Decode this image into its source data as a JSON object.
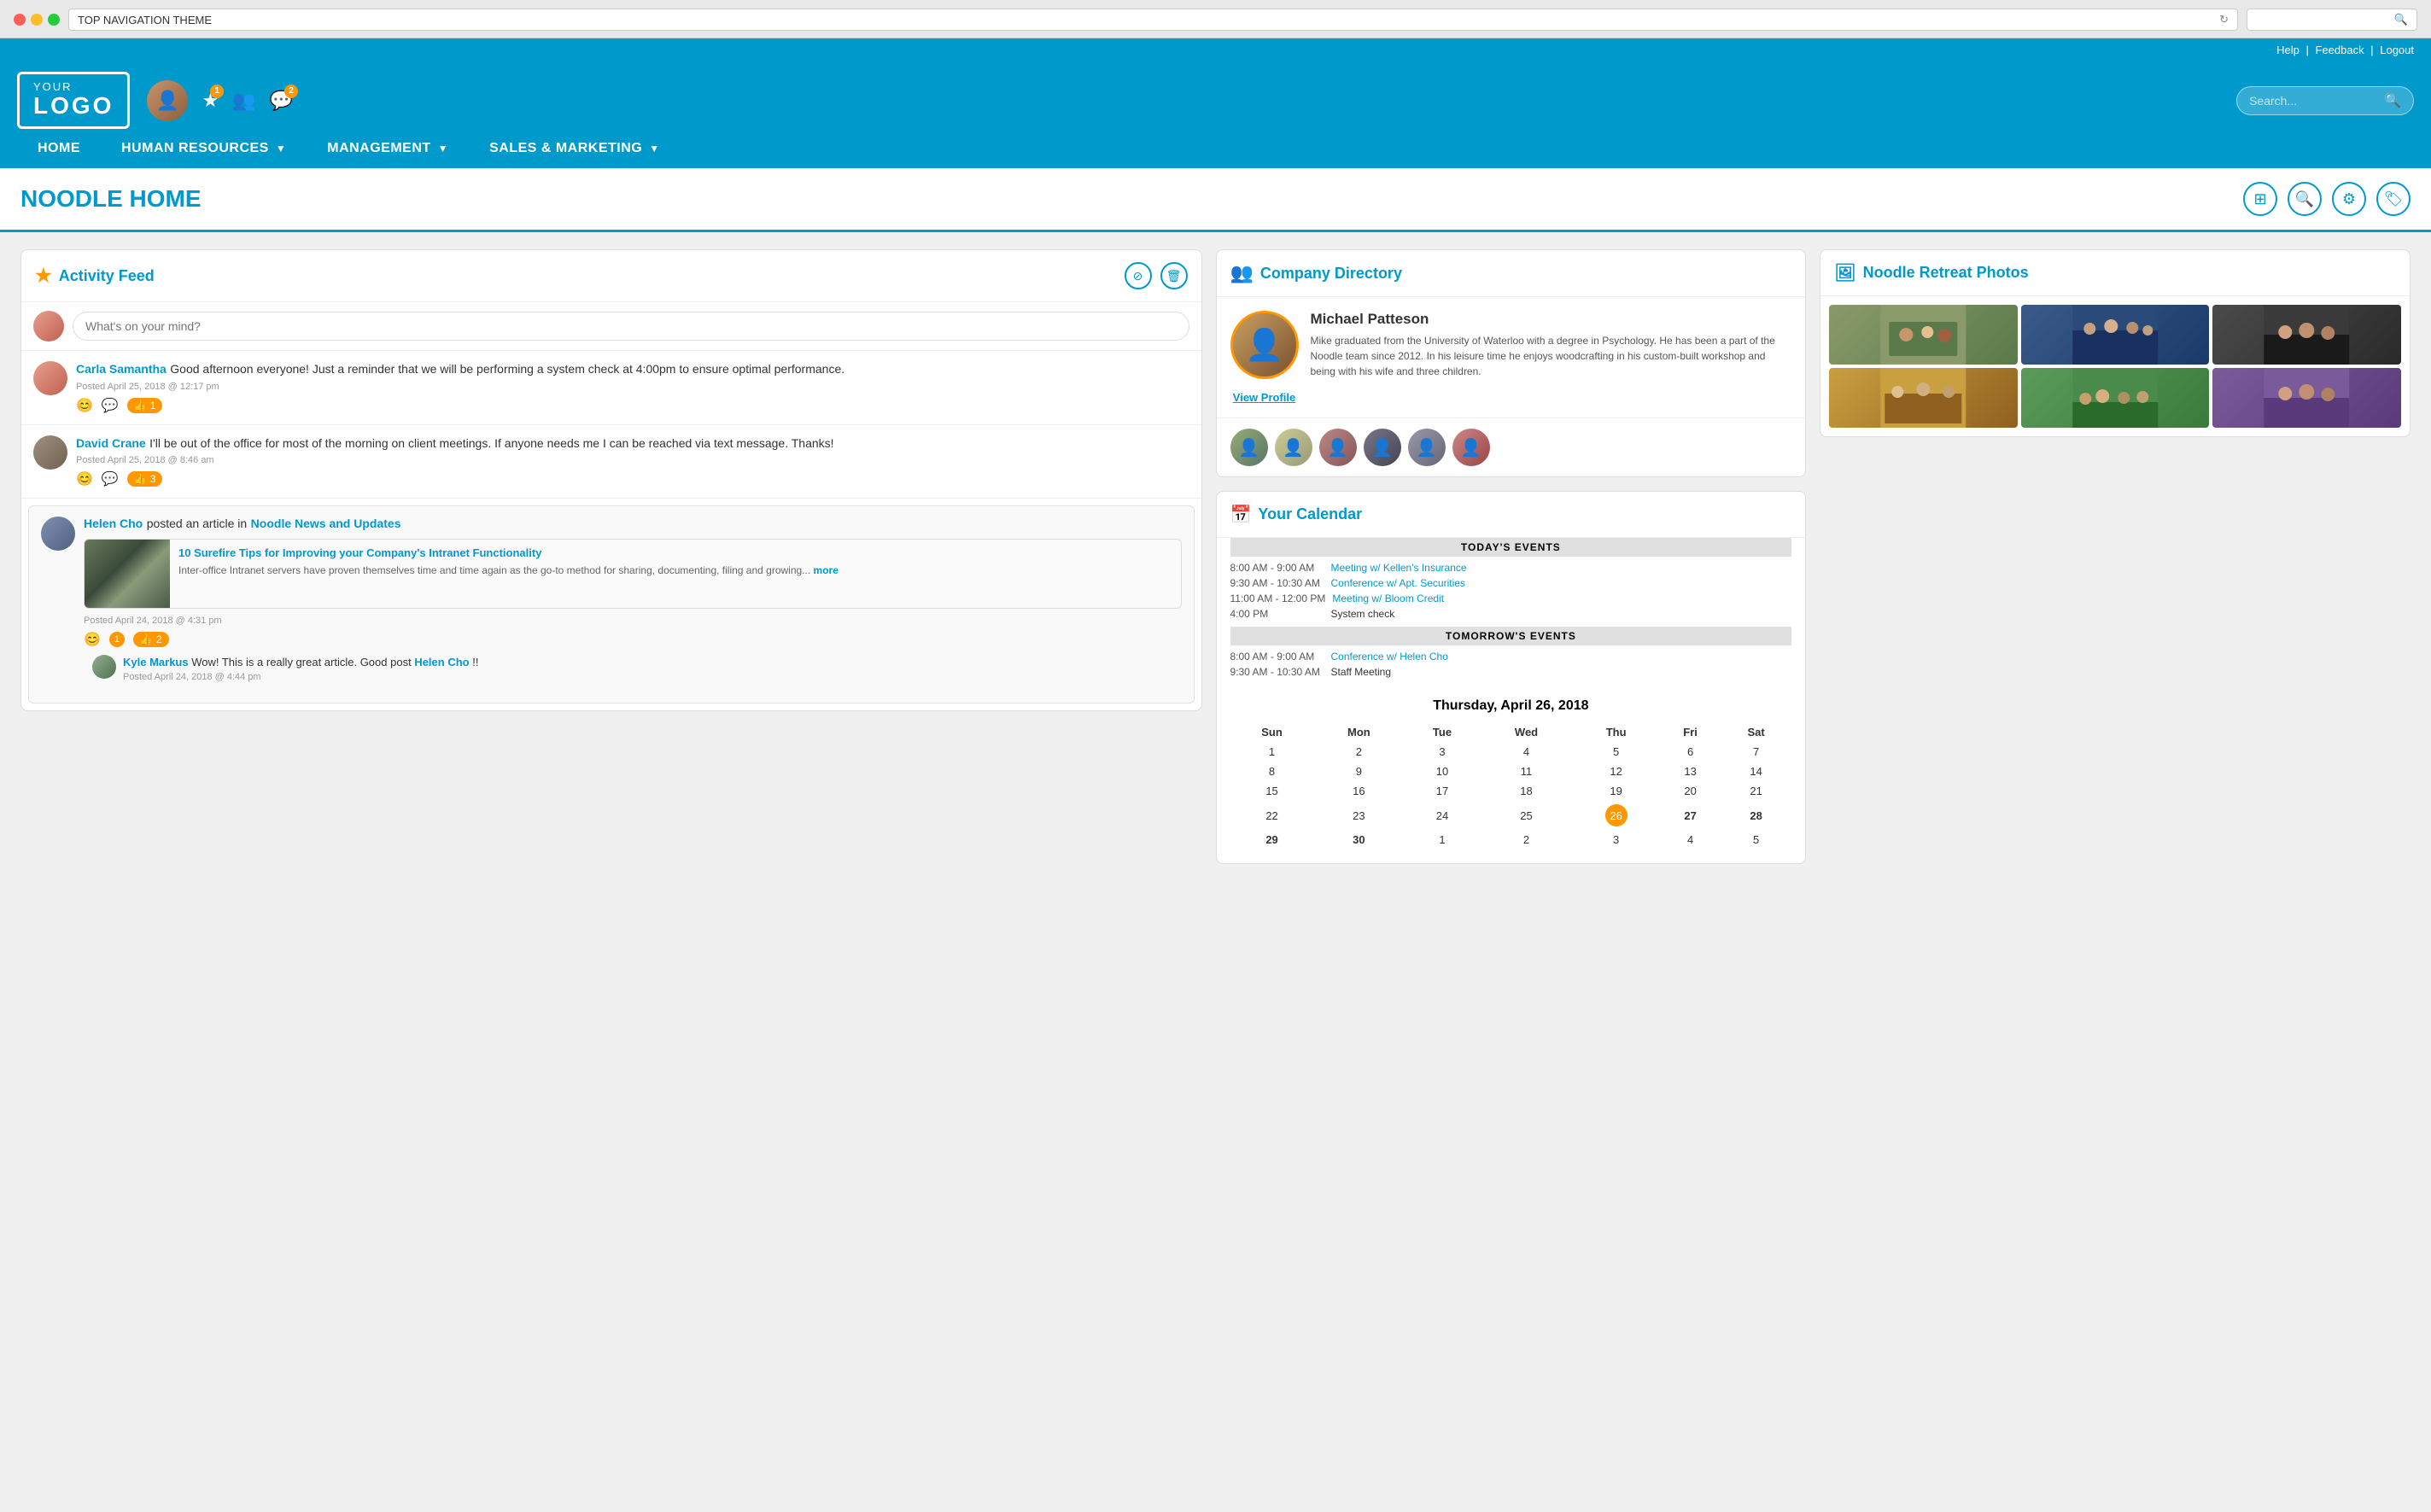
{
  "browser": {
    "tab_title": "TOP NAVIGATION THEME",
    "reload_icon": "↻",
    "search_icon": "🔍"
  },
  "utility_bar": {
    "help": "Help",
    "separator1": "|",
    "feedback": "Feedback",
    "separator2": "|",
    "logout": "Logout"
  },
  "header": {
    "logo_line1": "YOUR",
    "logo_line2": "LOGO",
    "user_avatar_label": "User avatar",
    "star_badge": "1",
    "chat_badge": "2",
    "search_placeholder": "Search...",
    "search_icon": "🔍"
  },
  "nav": {
    "items": [
      {
        "label": "HOME",
        "has_arrow": false
      },
      {
        "label": "HUMAN RESOURCES",
        "has_arrow": true
      },
      {
        "label": "MANAGEMENT",
        "has_arrow": true
      },
      {
        "label": "SALES & MARKETING",
        "has_arrow": true
      }
    ]
  },
  "page": {
    "title": "NOODLE HOME",
    "actions": [
      "copy-icon",
      "search-icon",
      "settings-icon",
      "tag-icon"
    ]
  },
  "activity_feed": {
    "section_title": "Activity Feed",
    "compose_placeholder": "What's on your mind?",
    "filter_icon": "⊘",
    "delete_icon": "🗑",
    "posts": [
      {
        "author": "Carla Samantha",
        "text": "Good afternoon everyone! Just a reminder that we will be performing a system check at 4:00pm to ensure optimal performance.",
        "timestamp": "Posted April 25, 2018 @ 12:17 pm",
        "likes": "1",
        "av_class": "av-carla"
      },
      {
        "author": "David Crane",
        "text": "I'll be out of the office for most of the morning on client meetings. If anyone needs me I can be reached via text message. Thanks!",
        "timestamp": "Posted April 25, 2018 @ 8:46 am",
        "likes": "3",
        "av_class": "av-david"
      }
    ],
    "article_post": {
      "author": "Helen Cho",
      "posted_in": "posted an article in",
      "channel": "Noodle News and Updates",
      "article_title": "10 Surefire Tips for Improving your Company's Intranet Functionality",
      "article_excerpt": "Inter-office Intranet servers have proven themselves time and time again as the go-to method for sharing, documenting, filing and growing...",
      "more_label": "more",
      "timestamp": "Posted April 24, 2018 @ 4:31 pm",
      "likes": "2",
      "comments_count": "1",
      "av_class": "av-helen"
    },
    "comment": {
      "author": "Kyle Markus",
      "text": "Wow! This is a really great article. Good post",
      "mention": "Helen Cho",
      "exclamation": "!!",
      "timestamp": "Posted April 24, 2018 @ 4:44 pm",
      "av_class": "av-kyle"
    }
  },
  "company_directory": {
    "section_title": "Company Directory",
    "person": {
      "name": "Michael Patteson",
      "bio": "Mike graduated from the University of Waterloo with a degree in Psychology. He has been a part of the Noodle team since 2012. In his leisure time he enjoys woodcrafting in his custom-built workshop and being with his wife and three children.",
      "view_profile": "View Profile"
    },
    "other_people": 6
  },
  "photos": {
    "section_title": "Noodle Retreat Photos",
    "count": 6
  },
  "calendar": {
    "section_title": "Your Calendar",
    "current_date": "Thursday, April 26, 2018",
    "today_events_label": "TODAY'S EVENTS",
    "tomorrow_events_label": "TOMORROW'S EVENTS",
    "today_events": [
      {
        "time": "8:00 AM - 9:00 AM",
        "name": "Meeting w/ Kellen's Insurance",
        "is_link": true
      },
      {
        "time": "9:30 AM - 10:30 AM",
        "name": "Conference w/ Apt. Securities",
        "is_link": true
      },
      {
        "time": "11:00 AM - 12:00 PM",
        "name": "Meeting w/ Bloom Credit",
        "is_link": true
      },
      {
        "time": "4:00 PM",
        "name": "System check",
        "is_link": false
      }
    ],
    "tomorrow_events": [
      {
        "time": "8:00 AM - 9:00 AM",
        "name": "Conference w/ Helen Cho",
        "is_link": true
      },
      {
        "time": "9:30 AM - 10:30 AM",
        "name": "Staff Meeting",
        "is_link": false
      }
    ],
    "month": "April",
    "year": "2018",
    "day_headers": [
      "Sun",
      "Mon",
      "Tue",
      "Wed",
      "Thu",
      "Fri",
      "Sat"
    ],
    "weeks": [
      [
        "1",
        "2",
        "3",
        "4",
        "5",
        "6",
        "7"
      ],
      [
        "8",
        "9",
        "10",
        "11",
        "12",
        "13",
        "14"
      ],
      [
        "15",
        "16",
        "17",
        "18",
        "19",
        "20",
        "21"
      ],
      [
        "22",
        "23",
        "24",
        "25",
        "26",
        "27",
        "28"
      ],
      [
        "29",
        "30",
        "1",
        "2",
        "3",
        "4",
        "5"
      ]
    ],
    "today_date": "26",
    "highlighted_dates": [
      "27",
      "28"
    ],
    "last_row_other": [
      "1",
      "2",
      "3",
      "4",
      "5"
    ]
  }
}
